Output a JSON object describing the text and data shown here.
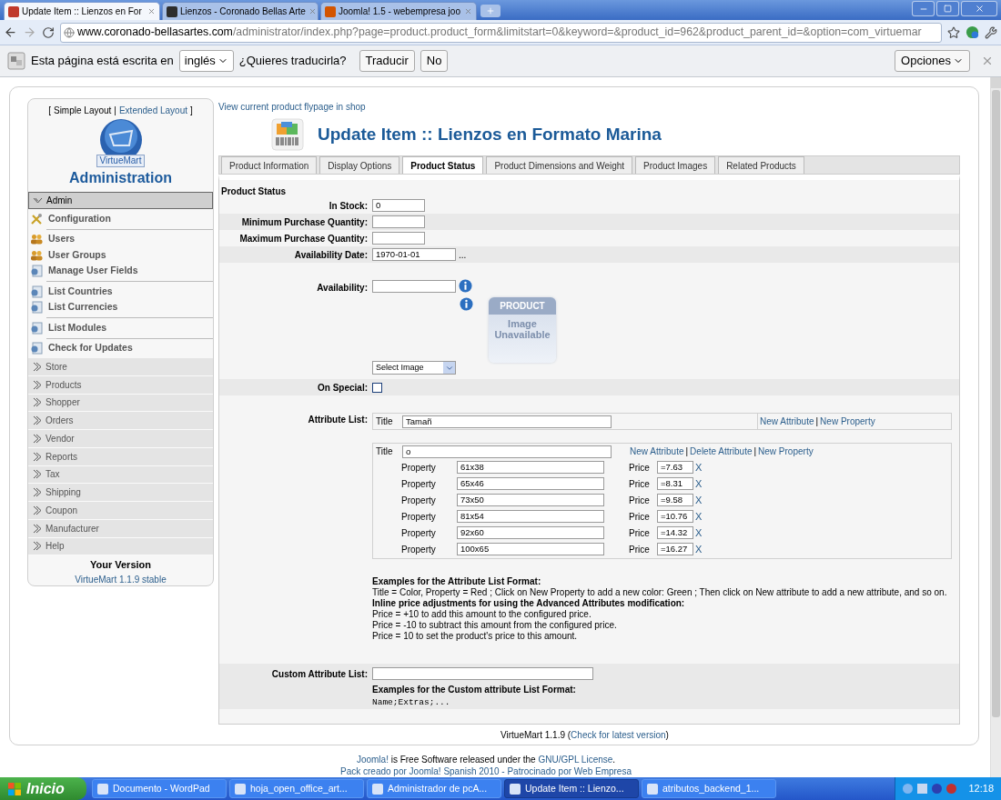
{
  "browser": {
    "tabs": [
      {
        "title": "Update Item :: Lienzos en For",
        "selected": true,
        "color": "#c0392b"
      },
      {
        "title": "Lienzos - Coronado Bellas Arte",
        "selected": false,
        "color": "#2d2d2d"
      },
      {
        "title": "Joomla! 1.5 - webempresa joo",
        "selected": false,
        "color": "#d35400"
      }
    ],
    "url_host": "www.coronado-bellasartes.com",
    "url_path": "/administrator/index.php?page=product.product_form&limitstart=0&keyword=&product_id=962&product_parent_id=&option=com_virtuemar",
    "translate": {
      "text": "Esta página está escrita en",
      "language": "inglés",
      "question": "¿Quieres traducirla?",
      "translate_button": "Traducir",
      "no_button": "No",
      "options_button": "Opciones"
    }
  },
  "sidebar": {
    "layout_open": "[",
    "layouts": [
      {
        "label": "Simple Layout",
        "selected": true
      },
      {
        "label": "Extended Layout",
        "selected": false
      }
    ],
    "layout_separator": "|",
    "layout_close": "]",
    "logo_text": "VirtueMart",
    "title": "Administration",
    "sections": [
      {
        "label": "Admin",
        "expanded": true,
        "groups": [
          [
            {
              "label": "Configuration",
              "kind": "tools"
            }
          ],
          [
            {
              "label": "Users",
              "kind": "users"
            },
            {
              "label": "User Groups",
              "kind": "users"
            },
            {
              "label": "Manage User Fields",
              "kind": "page"
            }
          ],
          [
            {
              "label": "List Countries",
              "kind": "page"
            },
            {
              "label": "List Currencies",
              "kind": "page"
            }
          ],
          [
            {
              "label": "List Modules",
              "kind": "page"
            }
          ],
          [
            {
              "label": "Check for Updates",
              "kind": "page"
            }
          ]
        ]
      },
      {
        "label": "Store",
        "expanded": false
      },
      {
        "label": "Products",
        "expanded": false
      },
      {
        "label": "Shopper",
        "expanded": false
      },
      {
        "label": "Orders",
        "expanded": false
      },
      {
        "label": "Vendor",
        "expanded": false
      },
      {
        "label": "Reports",
        "expanded": false
      },
      {
        "label": "Tax",
        "expanded": false
      },
      {
        "label": "Shipping",
        "expanded": false
      },
      {
        "label": "Coupon",
        "expanded": false
      },
      {
        "label": "Manufacturer",
        "expanded": false
      },
      {
        "label": "Help",
        "expanded": false
      }
    ],
    "version_title": "Your Version",
    "version_link": "VirtueMart 1.1.9 stable"
  },
  "main": {
    "flypage_link": "View current product flypage in shop",
    "heading": "Update Item :: Lienzos en Formato Marina",
    "tabs": [
      {
        "label": "Product Information",
        "selected": false
      },
      {
        "label": "Display Options",
        "selected": false
      },
      {
        "label": "Product Status",
        "selected": true
      },
      {
        "label": "Product Dimensions and Weight",
        "selected": false
      },
      {
        "label": "Product Images",
        "selected": false
      },
      {
        "label": "Related Products",
        "selected": false
      }
    ],
    "section_title": "Product Status",
    "fields": [
      {
        "label": "In Stock:",
        "value": "0",
        "kind": "short"
      },
      {
        "label": "Minimum Purchase Quantity:",
        "kind": "short"
      },
      {
        "label": "Maximum Purchase Quantity:",
        "kind": "short"
      },
      {
        "label": "Availability Date:",
        "value": "1970-01-01",
        "kind": "date",
        "button": "..."
      }
    ],
    "availability": {
      "label": "Availability:",
      "select": "Select Image",
      "image_line1": "PRODUCT",
      "image_line2": "Image Unavailable"
    },
    "on_special": {
      "label": "On Special:",
      "checked": false
    },
    "attribute_list": {
      "label": "Attribute List:",
      "attributes": [
        {
          "title_label": "Title",
          "title": "Tamañ",
          "boxed_links": true,
          "links": [
            {
              "text": "New Attribute",
              "kind": "link"
            },
            {
              "text": "|",
              "kind": "sep"
            },
            {
              "text": "New Property",
              "kind": "link"
            }
          ]
        },
        {
          "title_label": "Title",
          "title": "o",
          "boxed_links": false,
          "links": [
            {
              "text": "New Attribute",
              "kind": "link"
            },
            {
              "text": "|",
              "kind": "sep"
            },
            {
              "text": "Delete Attribute",
              "kind": "link"
            },
            {
              "text": "|",
              "kind": "sep"
            },
            {
              "text": "New Property",
              "kind": "link"
            }
          ],
          "properties": [
            {
              "label": "Property",
              "value": "61x38",
              "price_label": "Price",
              "price": "=7.63",
              "remove": "X"
            },
            {
              "label": "Property",
              "value": "65x46",
              "price_label": "Price",
              "price": "=8.31",
              "remove": "X"
            },
            {
              "label": "Property",
              "value": "73x50",
              "price_label": "Price",
              "price": "=9.58",
              "remove": "X"
            },
            {
              "label": "Property",
              "value": "81x54",
              "price_label": "Price",
              "price": "=10.76",
              "remove": "X"
            },
            {
              "label": "Property",
              "value": "92x60",
              "price_label": "Price",
              "price": "=14.32",
              "remove": "X"
            },
            {
              "label": "Property",
              "value": "100x65",
              "price_label": "Price",
              "price": "=16.27",
              "remove": "X"
            }
          ]
        }
      ],
      "examples": [
        {
          "text": "Examples for the Attribute List Format:",
          "bold": true
        },
        {
          "text": "Title = Color, Property = Red ; Click on New Property to add a new color: Green ; Then click on New attribute to add a new attribute, and so on.",
          "bold": false
        },
        {
          "text": "Inline price adjustments for using the Advanced Attributes modification:",
          "bold": true
        },
        {
          "text": "Price = +10 to add this amount to the configured price.",
          "bold": false
        },
        {
          "text": "Price = -10 to subtract this amount from the configured price.",
          "bold": false
        },
        {
          "text": "Price = 10 to set the product's price to this amount.",
          "bold": false
        }
      ]
    },
    "custom_attribute": {
      "label": "Custom Attribute List:",
      "examples_title": "Examples for the Custom attribute List Format:",
      "example_code": "Name;Extras;..."
    }
  },
  "footer": {
    "version": [
      {
        "text": "VirtueMart 1.1.9 (",
        "kind": "plain"
      },
      {
        "text": "Check for latest version",
        "kind": "link"
      },
      {
        "text": ")",
        "kind": "plain"
      }
    ],
    "license": [
      {
        "text": "Joomla!",
        "kind": "link"
      },
      {
        "text": " is Free Software released under the ",
        "kind": "plain"
      },
      {
        "text": "GNU/GPL License",
        "kind": "link"
      },
      {
        "text": ".",
        "kind": "plain"
      }
    ],
    "credits": "Pack creado por Joomla! Spanish 2010 - Patrocinado por Web Empresa"
  },
  "taskbar": {
    "start": "Inicio",
    "items": [
      {
        "label": "Documento - WordPad",
        "selected": false
      },
      {
        "label": "hoja_open_office_art...",
        "selected": false
      },
      {
        "label": "Administrador de pcA...",
        "selected": false
      },
      {
        "label": "Update Item :: Lienzo...",
        "selected": true
      },
      {
        "label": "atributos_backend_1...",
        "selected": false
      }
    ],
    "clock": "12:18"
  }
}
